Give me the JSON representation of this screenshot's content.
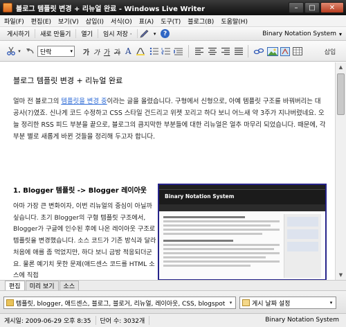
{
  "window": {
    "title": "블로그 템플릿 변경 + 리뉴얼 완료 - Windows Live Writer",
    "minimize": "–",
    "maximize": "□",
    "close": "✕"
  },
  "menu": [
    "파일(F)",
    "편집(E)",
    "보기(V)",
    "삽입(I)",
    "서식(O)",
    "표(A)",
    "도구(T)",
    "블로그(B)",
    "도움말(H)"
  ],
  "commands": {
    "publish": "게시하기",
    "new": "새로 만들기",
    "open": "열기",
    "save_draft": "임시 저장 ·",
    "blog_name": "Binary Notation System"
  },
  "format_toolbar": {
    "style": "단락",
    "bold": "가",
    "italic": "가",
    "underline": "가",
    "strike": "가",
    "insert": "삽입"
  },
  "document": {
    "title": "블로그 템플릿 변경 + 리뉴얼 완료",
    "intro_before_link": "얼마 전 블로그의 ",
    "intro_link": "템플릿을 변경 중",
    "intro_after_link": "이라는 글을 올렸습니다. 구형에서 신형으로, 아예 템플릿 구조를 바꿔버리는 대공사(?)였죠. 신나게 코드 수정하고 CSS 스타일 건드리고 위젯 꼬리고 하다 보니 어느새 약 3주가 지나버렸네요. 오늘 정리한 RSS 피드 부분을 끝으로, 블로그의 큼지막한 부분들에 대한 리뉴얼은 얼추 마무리 되었습니다. 때문에, 각 부분 별로 새롭게 바뀐 것들을 정리해 두고자 합니다.",
    "section1_title": "1. Blogger 템플릿 -> Blogger 레이아웃",
    "section1_body": "아마 가장 큰 변화이자, 이번 리뉴얼의 중심이 아닐까 싶습니다. 초기 Blogger의 구형 템플릿 구조에서, Blogger가 구글에 인수된 후에 나온 레이아웃 구조로 템플릿을 변경했습니다. 소스 코드가 기존 방식과 달라 처음에 애를 좀 먹었지만, 하다 보니 금방 적응되더군요. 물론 예기치 못한 문제(애드센스 코드를 HTML 소스에 직접",
    "screenshot_blog_title": "Binary Notation System"
  },
  "view_tabs": [
    "편집",
    "미리 보기",
    "소스"
  ],
  "categories_text": "템플릿, blogger, 애드센스, 블로그, 블로거, 리뉴얼, 레이아웃, CSS, blogspot",
  "date_field": "게시 날짜 설정",
  "status": {
    "saved": "게시일: 2009-06-29 오후 8:35",
    "words": "단어 수: 3032개",
    "blog": "Binary Notation System"
  }
}
